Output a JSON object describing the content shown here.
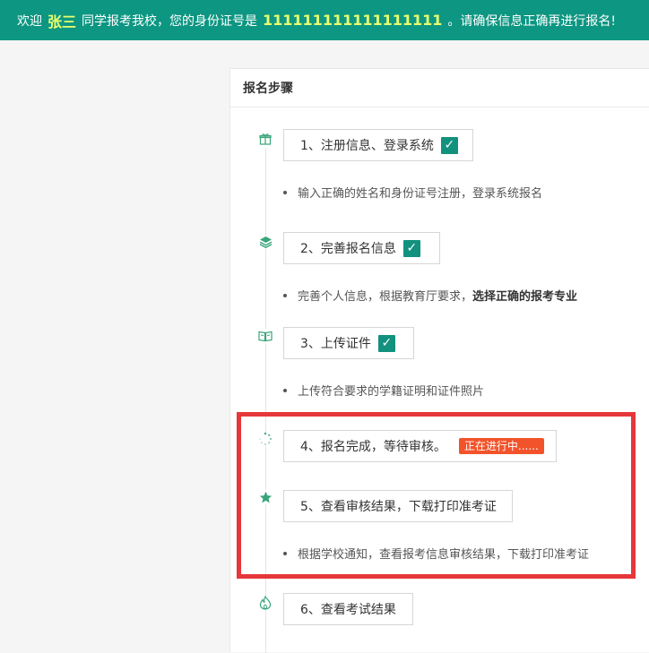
{
  "banner": {
    "welcome": "欢迎",
    "name": "张三",
    "mid": "同学报考我校，您的身份证号是",
    "id_number": "111111111111111111",
    "tail": "。请确保信息正确再进行报名!"
  },
  "panel": {
    "title": "报名步骤"
  },
  "steps": [
    {
      "label": "1、注册信息、登录系统",
      "icon": "gift-icon",
      "done": true,
      "note": "输入正确的姓名和身份证号注册，登录系统报名"
    },
    {
      "label": "2、完善报名信息",
      "icon": "layers-icon",
      "done": true,
      "note_prefix": "完善个人信息，根据教育厅要求，",
      "note_bold": "选择正确的报考专业"
    },
    {
      "label": "3、上传证件",
      "icon": "book-icon",
      "done": true,
      "note": "上传符合要求的学籍证明和证件照片"
    },
    {
      "label": "4、报名完成，等待审核。",
      "icon": "spinner-icon",
      "done": false,
      "status": "正在进行中......"
    },
    {
      "label": "5、查看审核结果，下载打印准考证",
      "icon": "star-icon",
      "done": false,
      "note": "根据学校通知，查看报考信息审核结果，下载打印准考证"
    },
    {
      "label": "6、查看考试结果",
      "icon": "fire-icon",
      "done": false
    }
  ],
  "check_mark": "✓",
  "colors": {
    "banner_bg": "#0d9682",
    "highlight_text": "#e8ff6e",
    "check_bg": "#12917e",
    "progress_bg": "#f2532a",
    "highlight_frame": "#e6373a",
    "icon_green": "#3aa57a"
  }
}
